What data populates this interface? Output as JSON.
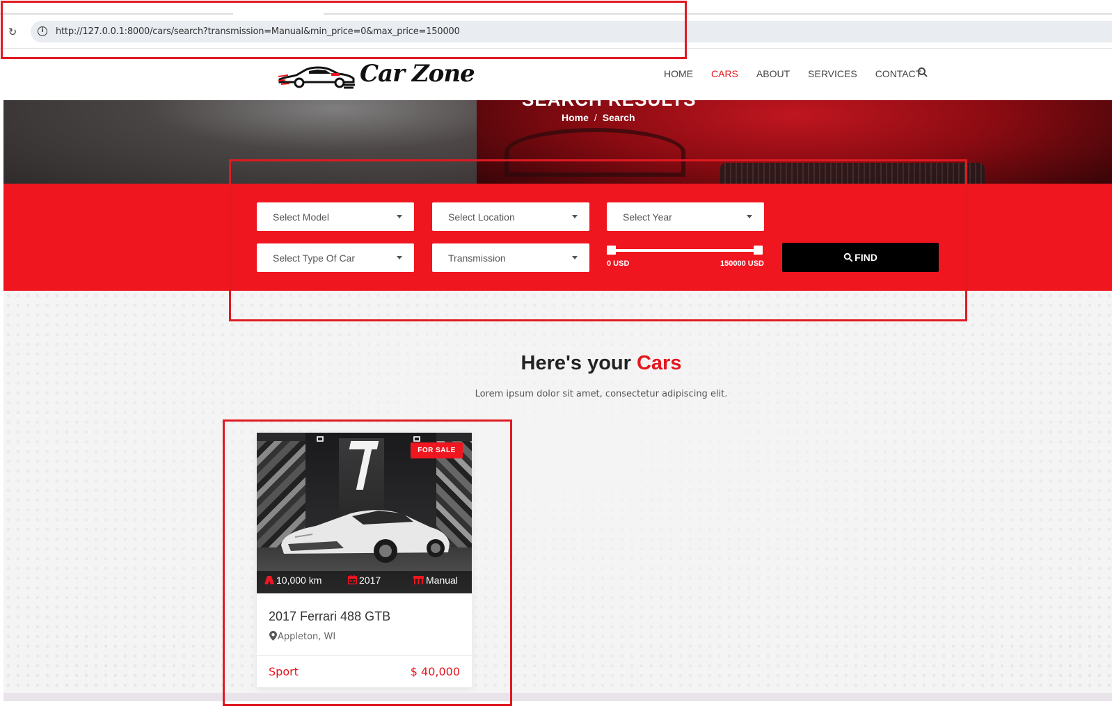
{
  "browser": {
    "url": "http://127.0.0.1:8000/cars/search?transmission=Manual&min_price=0&max_price=150000",
    "info_icon_glyph": "i",
    "reload_icon": "reload-icon"
  },
  "header": {
    "logo_text": "Car Zone",
    "nav": {
      "home": "HOME",
      "cars": "CARS",
      "about": "ABOUT",
      "services": "SERVICES",
      "contact": "CONTACT"
    },
    "active_nav": "cars",
    "search_icon": "search-icon"
  },
  "hero": {
    "title_partial": "SEARCH RESULTS",
    "breadcrumb": {
      "home": "Home",
      "separator": "/",
      "current": "Search"
    }
  },
  "search_form": {
    "model": {
      "value": "Select Model"
    },
    "location": {
      "value": "Select Location"
    },
    "year": {
      "value": "Select Year"
    },
    "body_type": {
      "value": "Select Type Of Car"
    },
    "transmission": {
      "value": "Transmission"
    },
    "price_range": {
      "min_label": "0 USD",
      "max_label": "150000 USD",
      "min": 0,
      "max": 150000,
      "selected_min": 0,
      "selected_max": 150000
    },
    "find_label": "FIND"
  },
  "results": {
    "title_prefix": "Here's your ",
    "title_accent": "Cars",
    "subtitle": "Lorem ipsum dolor sit amet, consectetur adipiscing elit.",
    "cars": [
      {
        "badge": "FOR SALE",
        "mileage": "10,000 km",
        "year": "2017",
        "transmission": "Manual",
        "title": "2017 Ferrari 488 GTB",
        "location": "Appleton, WI",
        "type": "Sport",
        "price": "$ 40,000"
      }
    ]
  },
  "colors": {
    "accent_red": "#ef1620",
    "text_red": "#e4161e",
    "find_button": "#000000",
    "annotation_red": "#e01a22"
  }
}
